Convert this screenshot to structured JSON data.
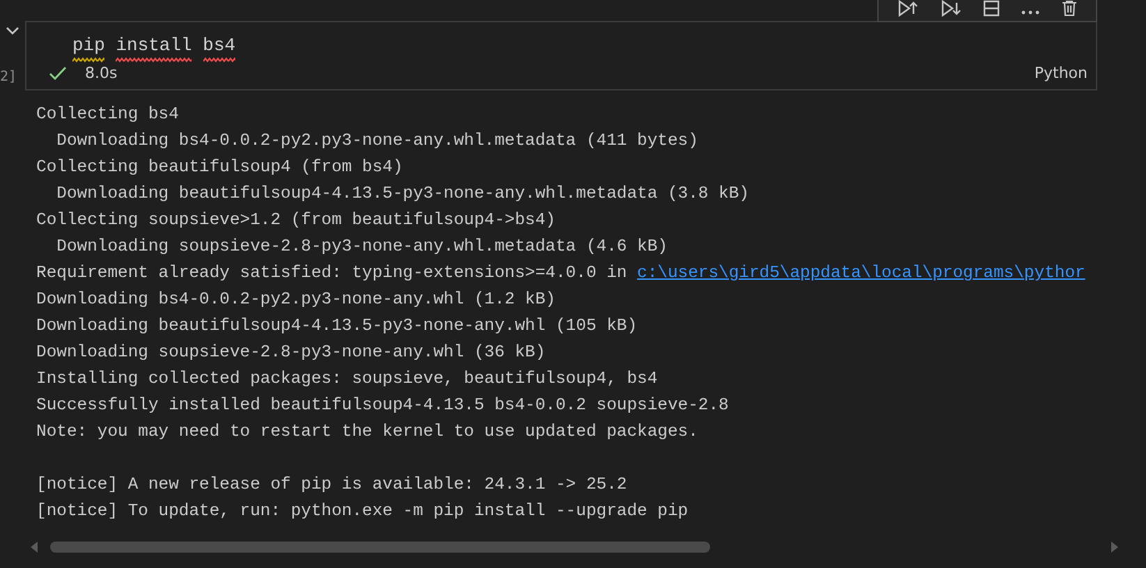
{
  "cell": {
    "execution_count": "2]",
    "expanded": true,
    "code": [
      {
        "text": "pip",
        "color": "#cca700"
      },
      {
        "text": "install",
        "color": "#f14c4c"
      },
      {
        "text": "bs4",
        "color": "#f14c4c"
      }
    ],
    "succeeded": true,
    "duration": "8.0s",
    "language": "Python"
  },
  "output": {
    "blocks": [
      [
        {
          "text": "Collecting bs4"
        },
        {
          "text": "  Downloading bs4-0.0.2-py2.py3-none-any.whl.metadata (411 bytes)"
        },
        {
          "text": "Collecting beautifulsoup4 (from bs4)"
        },
        {
          "text": "  Downloading beautifulsoup4-4.13.5-py3-none-any.whl.metadata (3.8 kB)"
        },
        {
          "text": "Collecting soupsieve>1.2 (from beautifulsoup4->bs4)"
        },
        {
          "text": "  Downloading soupsieve-2.8-py3-none-any.whl.metadata (4.6 kB)"
        },
        {
          "text": "Requirement already satisfied: typing-extensions>=4.0.0 in ",
          "link": "c:\\users\\gird5\\appdata\\local\\programs\\pythor"
        },
        {
          "text": "Downloading bs4-0.0.2-py2.py3-none-any.whl (1.2 kB)"
        },
        {
          "text": "Downloading beautifulsoup4-4.13.5-py3-none-any.whl (105 kB)"
        },
        {
          "text": "Downloading soupsieve-2.8-py3-none-any.whl (36 kB)"
        },
        {
          "text": "Installing collected packages: soupsieve, beautifulsoup4, bs4"
        },
        {
          "text": "Successfully installed beautifulsoup4-4.13.5 bs4-0.0.2 soupsieve-2.8"
        },
        {
          "text": "Note: you may need to restart the kernel to use updated packages."
        }
      ],
      [
        {
          "text": "[notice] A new release of pip is available: 24.3.1 -> 25.2"
        },
        {
          "text": "[notice] To update, run: python.exe -m pip install --upgrade pip"
        }
      ]
    ]
  }
}
